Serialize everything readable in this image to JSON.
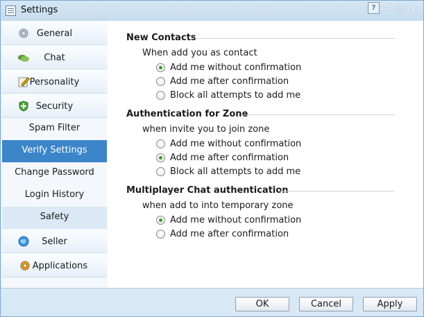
{
  "window": {
    "title": "Settings"
  },
  "title_buttons": {
    "help": "?",
    "minimize": "–",
    "maximize": "□",
    "close": "×"
  },
  "sidebar": {
    "items": [
      {
        "label": "General",
        "icon": "gear-icon"
      },
      {
        "label": "Chat",
        "icon": "chat-bubbles-icon"
      },
      {
        "label": "Personality",
        "icon": "pencil-note-icon"
      },
      {
        "label": "Security",
        "icon": "shield-icon"
      }
    ],
    "security_sub": [
      {
        "label": "Spam Filter"
      },
      {
        "label": "Verify Settings",
        "active": true
      },
      {
        "label": "Change Password"
      },
      {
        "label": "Login History"
      },
      {
        "label": "Safety",
        "hover": true
      }
    ],
    "items_after": [
      {
        "label": "Seller",
        "icon": "globe-icon"
      },
      {
        "label": "Applications",
        "icon": "applications-icon"
      }
    ]
  },
  "sections": [
    {
      "title": "New Contacts",
      "question": "When add you as contact",
      "options": [
        {
          "label": "Add me without confirmation",
          "checked": true
        },
        {
          "label": "Add me after confirmation",
          "checked": false
        },
        {
          "label": "Block all attempts to add me",
          "checked": false
        }
      ]
    },
    {
      "title": "Authentication for Zone",
      "question": "when invite you to join zone",
      "options": [
        {
          "label": "Add me without confirmation",
          "checked": false
        },
        {
          "label": "Add me after confirmation",
          "checked": true
        },
        {
          "label": "Block all attempts to add me",
          "checked": false
        }
      ]
    },
    {
      "title": "Multiplayer Chat authentication",
      "question": "when add to into temporary zone",
      "options": [
        {
          "label": "Add me without confirmation",
          "checked": true
        },
        {
          "label": "Add me after confirmation",
          "checked": false
        }
      ]
    }
  ],
  "footer": {
    "ok": "OK",
    "cancel": "Cancel",
    "apply": "Apply"
  },
  "colors": {
    "accent": "#3b85c8",
    "radio_checked": "#3f9b2e",
    "frame": "#d9e8f5"
  }
}
